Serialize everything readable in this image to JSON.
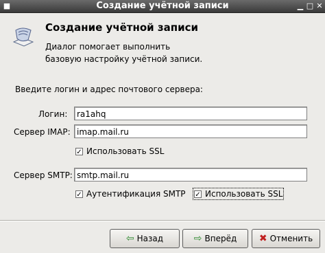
{
  "window": {
    "title": "Создание учётной записи"
  },
  "header": {
    "title": "Создание учётной записи",
    "description_line1": "Диалог помогает выполнить",
    "description_line2": "базовую настройку учётной записи."
  },
  "form": {
    "prompt": "Введите логин и адрес почтового сервера:",
    "login": {
      "label": "Логин:",
      "value": "ra1ahq"
    },
    "imap": {
      "label": "Сервер IMAP:",
      "value": "imap.mail.ru",
      "ssl_label": "Использовать SSL",
      "ssl_checked": true
    },
    "smtp": {
      "label": "Сервер SMTP:",
      "value": "smtp.mail.ru",
      "auth_label": "Аутентификация SMTP",
      "auth_checked": true,
      "ssl_label": "Использовать SSL",
      "ssl_checked": true
    }
  },
  "buttons": {
    "back": "Назад",
    "forward": "Вперёд",
    "cancel": "Отменить"
  },
  "icons": {
    "header": "mail-account-icon",
    "back": "arrow-left-icon",
    "forward": "arrow-right-icon",
    "cancel": "cancel-x-icon"
  }
}
